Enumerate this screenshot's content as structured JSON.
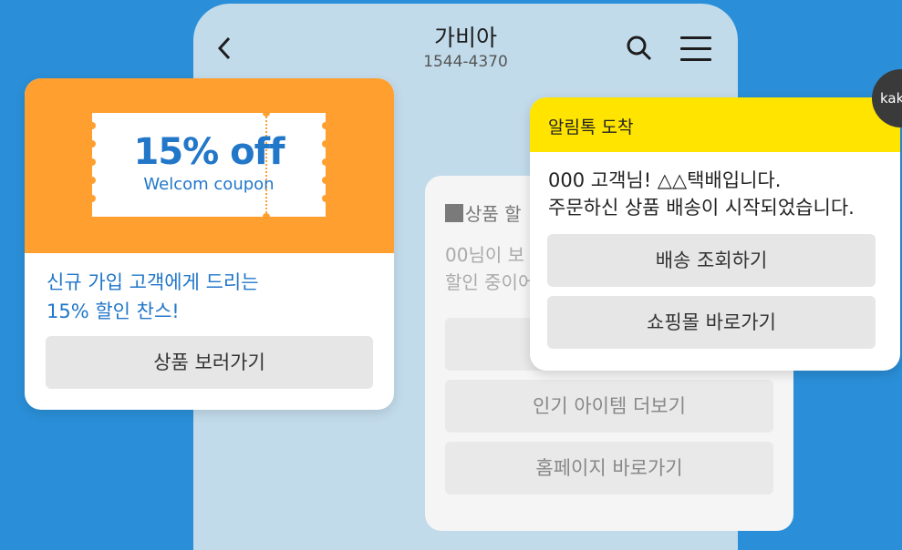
{
  "header": {
    "title": "가비아",
    "phone": "1544-4370"
  },
  "message_card": {
    "heading": "상품 할",
    "body_line1": "00님이 보",
    "body_line2": "할인 중이어",
    "button1": "",
    "button2": "인기 아이템 더보기",
    "button3": "홈페이지 바로가기"
  },
  "coupon_card": {
    "discount": "15% off",
    "subtitle": "Welcom coupon",
    "text_line1": "신규 가입 고객에게 드리는",
    "text_line2": "15% 할인 찬스!",
    "button": "상품 보러가기"
  },
  "alimtalk_card": {
    "header": "알림톡 도착",
    "message_line1": "000 고객님! △△택배입니다.",
    "message_line2": "주문하신 상품 배송이 시작되었습니다.",
    "button1": "배송 조회하기",
    "button2": "쇼핑몰 바로가기"
  },
  "kakao_badge": "kak",
  "colors": {
    "background": "#2a8fd8",
    "phone": "#c2dbeb",
    "coupon_orange": "#ff9f30",
    "alimtalk_yellow": "#ffe400",
    "accent_blue": "#2277c9"
  },
  "icons": [
    "back-chevron-icon",
    "search-icon",
    "hamburger-menu-icon"
  ]
}
